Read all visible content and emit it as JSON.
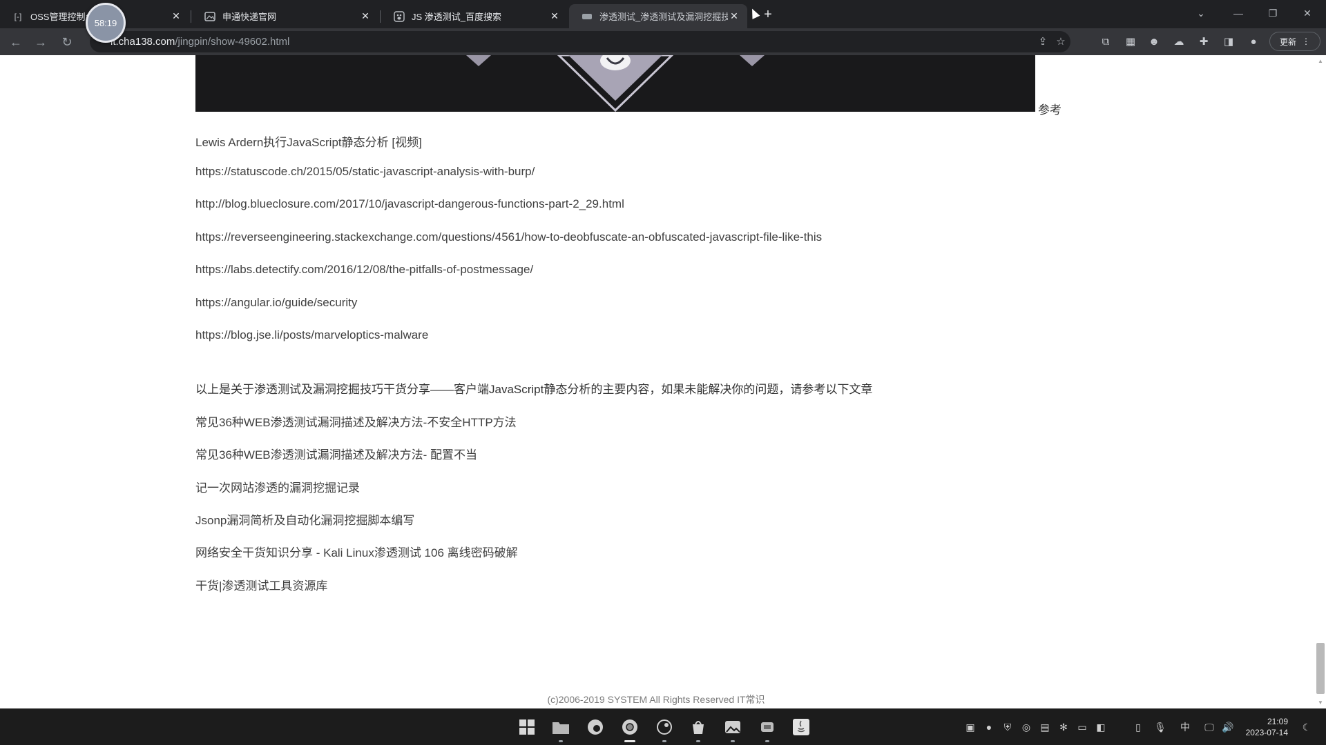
{
  "browser": {
    "tabs": [
      {
        "title": "OSS管理控制台",
        "favicon": "bracket-icon",
        "active": false
      },
      {
        "title": "申通快递官网",
        "favicon": "image-icon",
        "active": false
      },
      {
        "title": "JS 渗透测试_百度搜索",
        "favicon": "baidu-paw-icon",
        "active": false
      },
      {
        "title": "渗透测试_渗透测试及漏洞挖掘技",
        "favicon": "site-icon",
        "active": true
      }
    ],
    "recording_timer": "58:19",
    "address": {
      "host": "it.cha138.com",
      "path": "/jingpin/show-49602.html"
    },
    "update_button": "更新"
  },
  "page": {
    "reference_label": "参考",
    "links": [
      "Lewis Ardern执行JavaScript静态分析 [视频]",
      "https://statuscode.ch/2015/05/static-javascript-analysis-with-burp/",
      "http://blog.blueclosure.com/2017/10/javascript-dangerous-functions-part-2_29.html",
      "https://reverseengineering.stackexchange.com/questions/4561/how-to-deobfuscate-an-obfuscated-javascript-file-like-this",
      "https://labs.detectify.com/2016/12/08/the-pitfalls-of-postmessage/",
      "https://angular.io/guide/security",
      "https://blog.jse.li/posts/marveloptics-malware"
    ],
    "intro": "以上是关于渗透测试及漏洞挖掘技巧干货分享——客户端JavaScript静态分析的主要内容，如果未能解决你的问题，请参考以下文章",
    "related": [
      "常见36种WEB渗透测试漏洞描述及解决方法-不安全HTTP方法",
      "常见36种WEB渗透测试漏洞描述及解决方法- 配置不当",
      "记一次网站渗透的漏洞挖掘记录",
      "Jsonp漏洞简析及自动化漏洞挖掘脚本编写",
      "网络安全干货知识分享 - Kali Linux渗透测试 106 离线密码破解",
      "干货|渗透测试工具资源库"
    ],
    "footer": "(c)2006-2019 SYSTEM All Rights Reserved IT常识"
  },
  "taskbar": {
    "apps": [
      "windows-start-icon",
      "file-explorer-icon",
      "edge-icon",
      "chrome-icon",
      "steam-icon",
      "store-icon",
      "photos-icon",
      "app-icon",
      "java-icon"
    ],
    "ime": "中",
    "time": "21:09",
    "date": "2023-07-14"
  }
}
